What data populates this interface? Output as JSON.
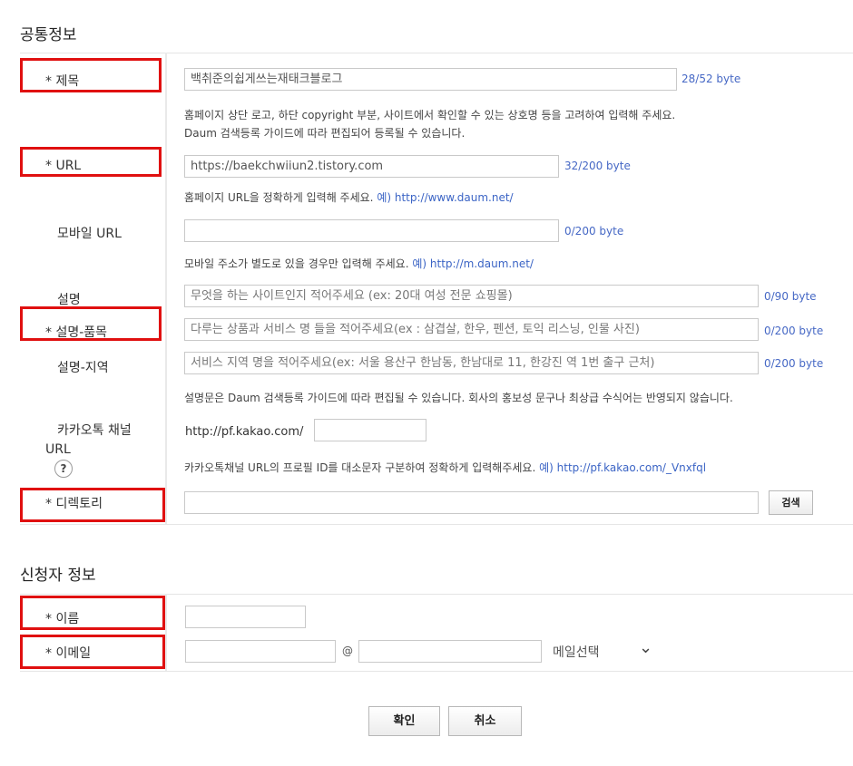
{
  "common": {
    "section_title": "공통정보",
    "title_label": "* 제목",
    "title_value": "백취준의쉽게쓰는재태크블로그",
    "title_count": "28/52 byte",
    "title_help_1": "홈페이지 상단 로고, 하단 copyright 부분, 사이트에서 확인할 수 있는 상호명 등을 고려하여 입력해 주세요.",
    "title_help_2": "Daum 검색등록 가이드에 따라 편집되어 등록될 수 있습니다.",
    "url_label": "* URL",
    "url_value": "https://baekchwiiun2.tistory.com",
    "url_count": "32/200 byte",
    "url_help": "홈페이지 URL을 정확하게 입력해 주세요.",
    "url_example": "예) http://www.daum.net/",
    "mobile_label": "모바일 URL",
    "mobile_value": "",
    "mobile_count": "0/200 byte",
    "mobile_help": "모바일 주소가 별도로 있을 경우만 입력해 주세요.",
    "mobile_example": "예) http://m.daum.net/",
    "desc_label": "설명",
    "desc_placeholder": "무엇을 하는 사이트인지 적어주세요 (ex: 20대 여성 전문 쇼핑몰)",
    "desc_count": "0/90 byte",
    "desc_item_label": "* 설명-품목",
    "desc_item_placeholder": "다루는 상품과 서비스 명 들을 적어주세요(ex : 삼겹살, 한우, 펜션, 토익 리스닝, 인물 사진)",
    "desc_item_count": "0/200 byte",
    "desc_region_label": "설명-지역",
    "desc_region_placeholder": "서비스 지역 명을 적어주세요(ex: 서울  용산구 한남동, 한남대로 11, 한강진 역 1번 출구 근처)",
    "desc_region_count": "0/200 byte",
    "desc_help": "설명문은 Daum 검색등록 가이드에 따라 편집될 수 있습니다. 회사의 홍보성 문구나 최상급 수식어는 반영되지 않습니다.",
    "kakao_label_1": "카카오톡 채널",
    "kakao_label_2": "URL",
    "kakao_prefix": "http://pf.kakao.com/",
    "kakao_value": "",
    "kakao_help": "카카오톡채널 URL의 프로필 ID를 대소문자 구분하여 정확하게 입력해주세요.",
    "kakao_example": "예) http://pf.kakao.com/_Vnxfql",
    "help_icon": "?",
    "dir_label": "* 디렉토리",
    "dir_value": "",
    "search_button": "검색"
  },
  "applicant": {
    "section_title": "신청자 정보",
    "name_label": "* 이름",
    "name_value": "",
    "email_label": "* 이메일",
    "email_local": "",
    "at": "@",
    "email_domain": "",
    "email_select": "메일선택",
    "chevron": "⌄"
  },
  "actions": {
    "confirm": "확인",
    "cancel": "취소"
  },
  "colors": {
    "highlight": "#e01010",
    "link": "#3b64c5",
    "count": "#4668c5"
  }
}
